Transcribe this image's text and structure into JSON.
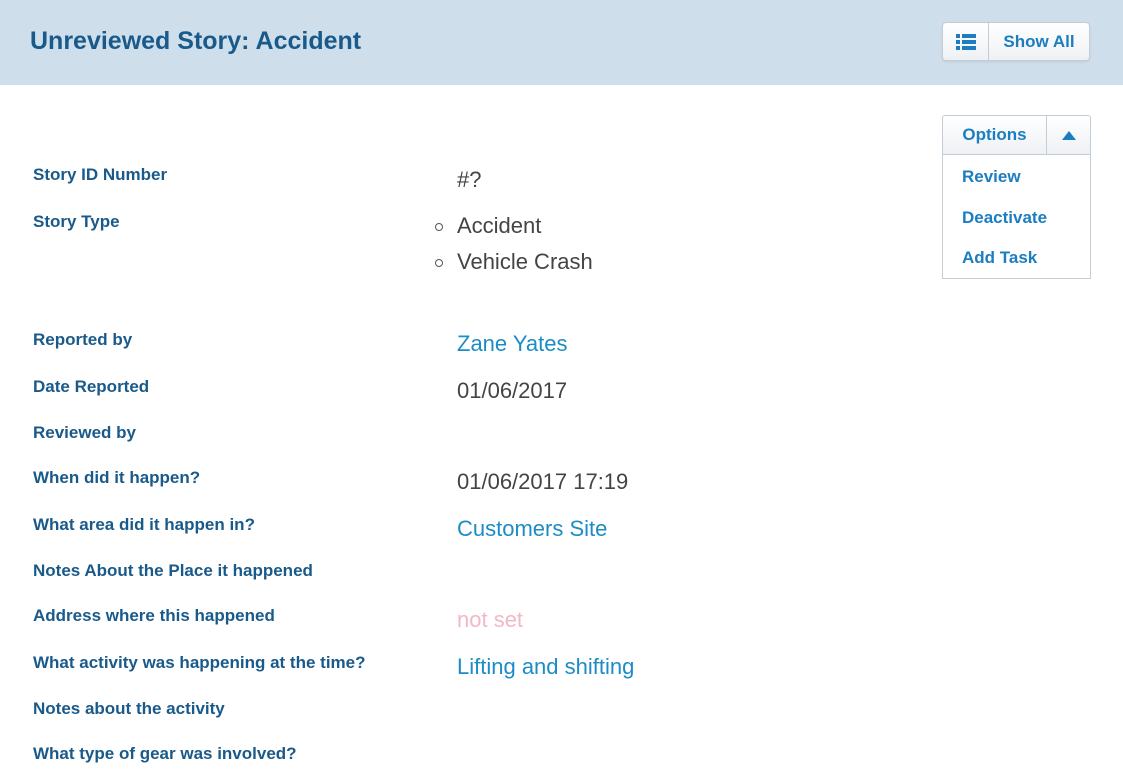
{
  "header": {
    "title": "Unreviewed Story: Accident",
    "show_all_label": "Show All",
    "show_all_icon": "list-icon"
  },
  "options": {
    "label": "Options",
    "caret_icon": "caret-up-icon",
    "menu": [
      "Review",
      "Deactivate",
      "Add Task"
    ]
  },
  "fields": {
    "story_id": {
      "label": "Story ID Number",
      "value": "#?"
    },
    "story_type": {
      "label": "Story Type",
      "values": [
        "Accident",
        "Vehicle Crash"
      ]
    },
    "reported_by": {
      "label": "Reported by",
      "value": "Zane Yates"
    },
    "date_reported": {
      "label": "Date Reported",
      "value": "01/06/2017"
    },
    "reviewed_by": {
      "label": "Reviewed by",
      "value": ""
    },
    "when": {
      "label": "When did it happen?",
      "value": "01/06/2017 17:19"
    },
    "area": {
      "label": "What area did it happen in?",
      "value": "Customers Site"
    },
    "place_notes": {
      "label": "Notes About the Place it happened",
      "value": ""
    },
    "address": {
      "label": "Address where this happened",
      "value": "not set"
    },
    "activity": {
      "label": "What activity was happening at the time?",
      "value": "Lifting and shifting"
    },
    "activity_notes": {
      "label": "Notes about the activity",
      "value": ""
    },
    "gear": {
      "label": "What type of gear was involved?",
      "value": ""
    }
  },
  "colors": {
    "header_bg": "#cfdeeb",
    "title": "#1a5a8a",
    "link": "#1c8cc6",
    "not_set": "#f2b8c6"
  }
}
